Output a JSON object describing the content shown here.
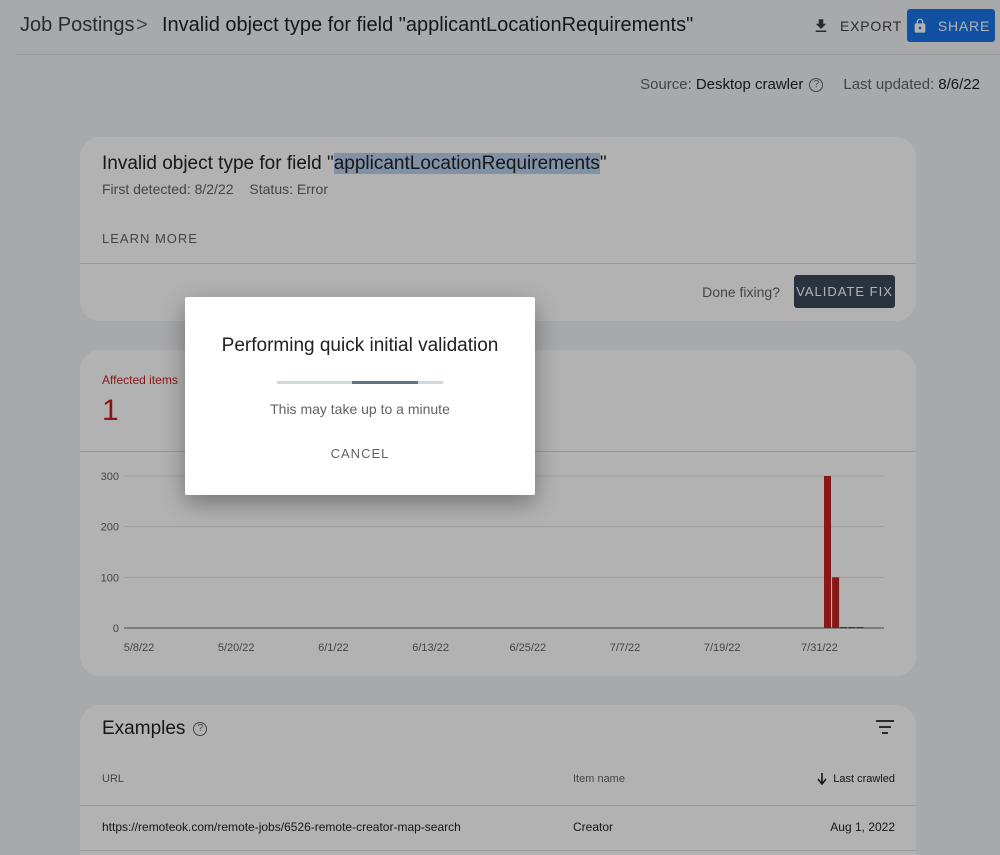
{
  "header": {
    "breadcrumb_root": "Job Postings",
    "breadcrumb_sep": ">",
    "page_title": "Invalid object type for field \"applicantLocationRequirements\"",
    "export_label": "EXPORT",
    "share_label": "SHARE",
    "export_icon": "download-icon",
    "share_icon": "lock-icon"
  },
  "meta": {
    "source_label": "Source:",
    "source_value": "Desktop crawler",
    "updated_label": "Last updated:",
    "updated_value": "8/6/22"
  },
  "issue": {
    "title_prefix": "Invalid object type for field \"",
    "title_highlight": "applicantLocationRequirements",
    "title_suffix": "\"",
    "first_detected": "First detected: 8/2/22",
    "status": "Status: Error",
    "learn_more": "LEARN MORE",
    "done_fixing": "Done fixing?",
    "validate_fix": "VALIDATE FIX"
  },
  "affected": {
    "label": "Affected items",
    "value": "1"
  },
  "chart_data": {
    "type": "bar",
    "title": "",
    "xlabel": "",
    "ylabel": "",
    "ylim": [
      0,
      300
    ],
    "yticks": [
      "300",
      "200",
      "100",
      "0"
    ],
    "xticks": [
      "5/8/22",
      "5/20/22",
      "6/1/22",
      "6/13/22",
      "6/25/22",
      "7/7/22",
      "7/19/22",
      "7/31/22"
    ],
    "categories": [
      "8/1/22",
      "8/2/22",
      "8/3/22",
      "8/4/22",
      "8/5/22"
    ],
    "values": [
      300,
      100,
      1,
      1,
      1
    ],
    "color": "#c5221f",
    "grid": true
  },
  "examples": {
    "title": "Examples",
    "col_url": "URL",
    "col_item": "Item name",
    "col_last": "Last crawled",
    "rows": [
      {
        "url": "https://remoteok.com/remote-jobs/6526-remote-creator-map-search",
        "item": "Creator",
        "last": "Aug 1, 2022"
      }
    ]
  },
  "dialog": {
    "title": "Performing quick initial validation",
    "subtitle": "This may take up to a minute",
    "cancel": "CANCEL",
    "progress": 0.45
  }
}
